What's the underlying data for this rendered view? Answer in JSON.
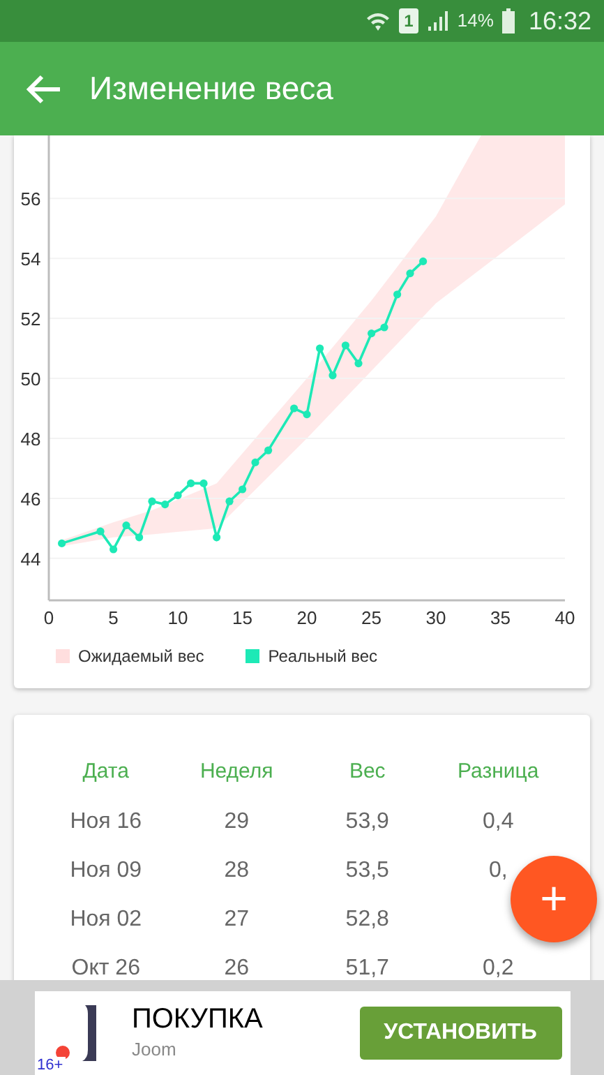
{
  "status_bar": {
    "battery": "14%",
    "time": "16:32",
    "sim": "1"
  },
  "app_bar": {
    "title": "Изменение веса"
  },
  "chart": {
    "chart_data": {
      "type": "line",
      "grid": true,
      "series": [
        {
          "name": "Реальный вес",
          "color": "#1de9b6",
          "marker": "circle",
          "x": [
            1,
            4,
            5,
            6,
            7,
            8,
            9,
            10,
            11,
            12,
            13,
            14,
            15,
            16,
            17,
            19,
            20,
            21,
            22,
            23,
            24,
            25,
            26,
            27,
            28,
            29
          ],
          "values": [
            44.5,
            44.9,
            44.3,
            45.1,
            44.7,
            45.9,
            45.8,
            46.1,
            46.5,
            46.5,
            44.7,
            45.9,
            46.3,
            47.2,
            47.6,
            49.0,
            48.8,
            51.0,
            50.1,
            51.1,
            50.5,
            51.5,
            51.7,
            52.8,
            53.5,
            53.9
          ]
        }
      ],
      "xlim": [
        0,
        40
      ],
      "ylim": [
        42.6,
        58.1
      ],
      "xticks": [
        0,
        5,
        10,
        15,
        20,
        25,
        30,
        35,
        40
      ],
      "yticks": [
        44,
        46,
        48,
        50,
        52,
        54,
        56
      ]
    },
    "band": {
      "label": "Ожидаемый вес",
      "color": "#ffdede"
    }
  },
  "table": {
    "columns": [
      "Дата",
      "Неделя",
      "Вес",
      "Разница"
    ],
    "rows": [
      [
        "Ноя 16",
        "29",
        "53,9",
        "0,4"
      ],
      [
        "Ноя 09",
        "28",
        "53,5",
        "0,"
      ],
      [
        "Ноя 02",
        "27",
        "52,8"
      ],
      [
        "Окт 26",
        "26",
        "51,7",
        "0,2"
      ]
    ]
  },
  "fab": {
    "label": "+"
  },
  "ad": {
    "title": "ПОКУПКА",
    "advertiser": "Joom",
    "button": "УСТАНОВИТЬ",
    "age": "16+"
  }
}
